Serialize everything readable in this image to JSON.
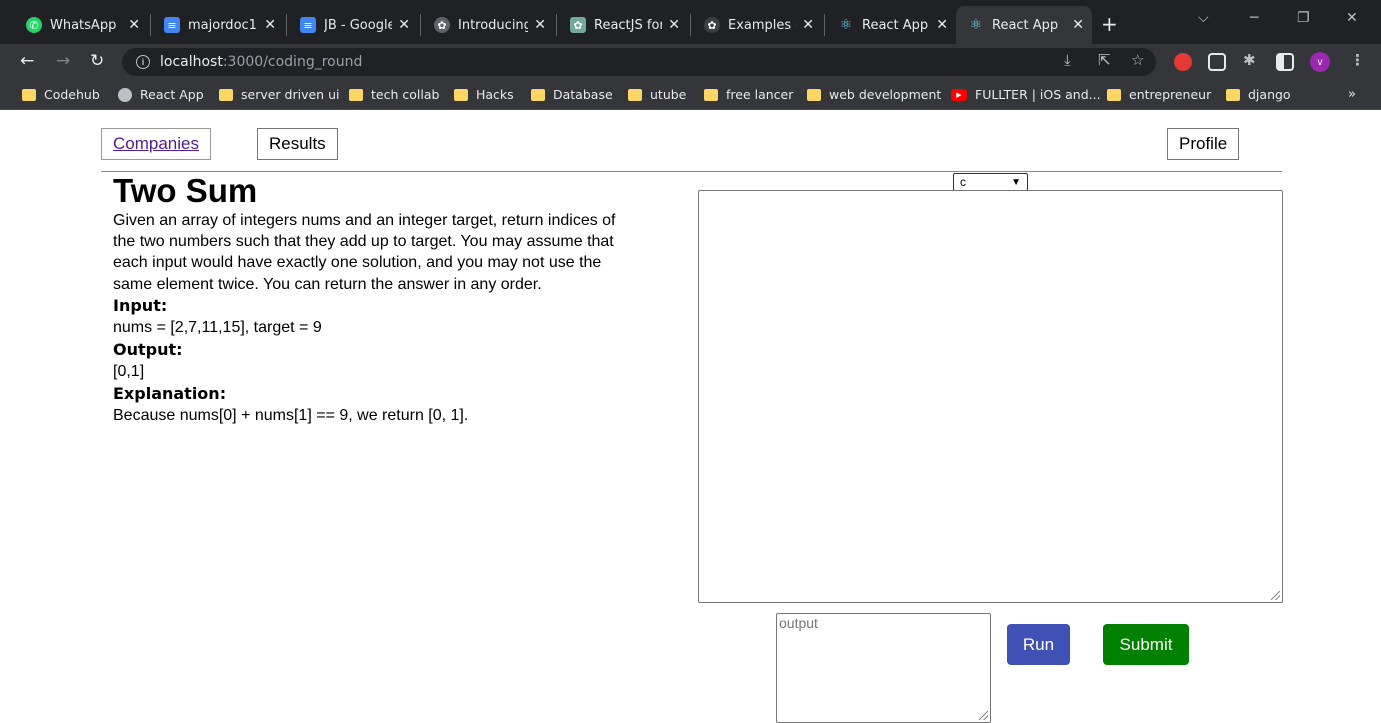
{
  "browser": {
    "tabs": [
      {
        "title": "WhatsApp",
        "icon": "whatsapp-icon"
      },
      {
        "title": "majordoc1",
        "icon": "google-docs-icon"
      },
      {
        "title": "JB - Google",
        "icon": "google-docs-icon"
      },
      {
        "title": "Introducing",
        "icon": "openai-icon"
      },
      {
        "title": "ReactJS for",
        "icon": "chatgpt-icon"
      },
      {
        "title": "Examples -",
        "icon": "openai-icon"
      },
      {
        "title": "React App",
        "icon": "react-icon"
      },
      {
        "title": "React App",
        "icon": "react-icon",
        "active": true
      }
    ],
    "url_host": "localhost",
    "url_path": ":3000/coding_round",
    "profile_initial": "v",
    "bookmarks": [
      {
        "label": "Codehub",
        "icon": "folder-icon"
      },
      {
        "label": "React App",
        "icon": "globe-icon"
      },
      {
        "label": "server driven ui",
        "icon": "folder-icon"
      },
      {
        "label": "tech collab",
        "icon": "folder-icon"
      },
      {
        "label": "Hacks",
        "icon": "folder-icon"
      },
      {
        "label": "Database",
        "icon": "folder-icon"
      },
      {
        "label": "utube",
        "icon": "folder-icon"
      },
      {
        "label": "free lancer",
        "icon": "folder-icon"
      },
      {
        "label": "web development",
        "icon": "folder-icon"
      },
      {
        "label": "FULLTER | iOS and...",
        "icon": "youtube-icon"
      },
      {
        "label": "entrepreneur",
        "icon": "folder-icon"
      },
      {
        "label": "django",
        "icon": "folder-icon"
      }
    ],
    "bookmarks_more": "»"
  },
  "nav": {
    "companies": "Companies",
    "results": "Results",
    "profile": "Profile"
  },
  "problem": {
    "title": "Two Sum",
    "description": "Given an array of integers nums and an integer target, return indices of the two numbers such that they add up to target. You may assume that each input would have exactly one solution, and you may not use the same element twice. You can return the answer in any order.",
    "input_label": "Input:",
    "input_value": "nums = [2,7,11,15], target = 9",
    "output_label": "Output:",
    "output_value": "[0,1]",
    "explanation_label": "Explanation:",
    "explanation_value": "Because nums[0] + nums[1] == 9, we return [0, 1]."
  },
  "editor": {
    "language": "c",
    "code": "",
    "output_placeholder": "output",
    "run_label": "Run",
    "submit_label": "Submit"
  },
  "colors": {
    "run_button": "#3f51b5",
    "submit_button": "#008000",
    "link": "#551a8b"
  }
}
